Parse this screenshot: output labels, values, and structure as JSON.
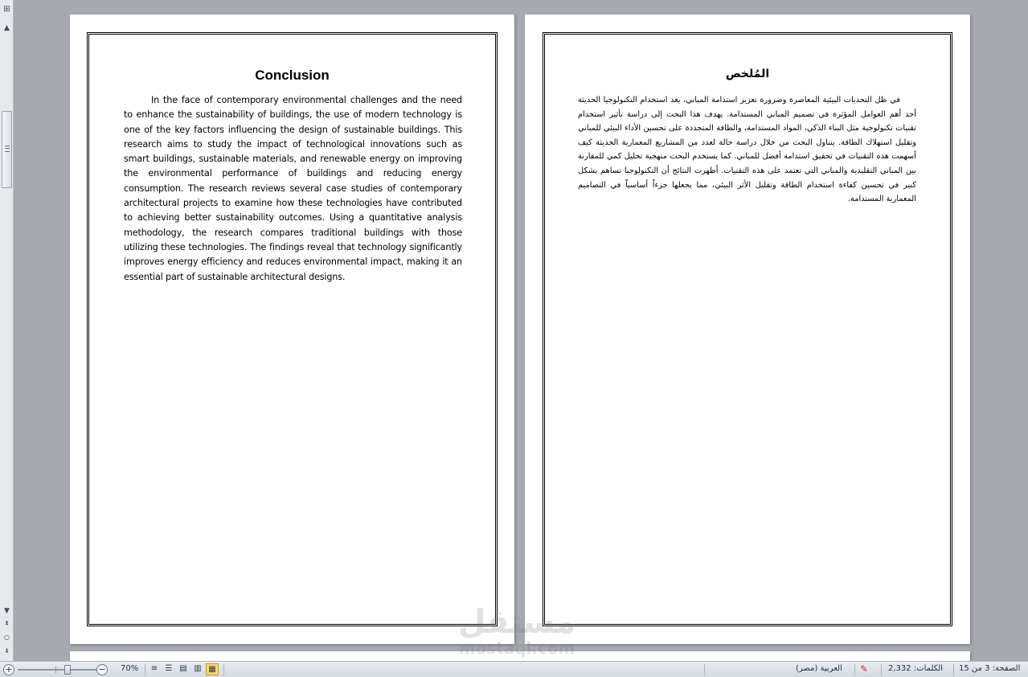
{
  "document": {
    "left_page": {
      "title": "Conclusion",
      "body": "In the face of contemporary environmental challenges and the need to enhance the sustainability of buildings, the use of modern technology is one of the key factors influencing the design of sustainable buildings. This research aims to study the impact of technological innovations such as smart buildings, sustainable materials, and renewable energy on improving the environmental performance of buildings and reducing energy consumption. The research reviews several case studies of contemporary architectural projects to examine how these technologies have contributed to achieving better sustainability outcomes. Using a quantitative analysis methodology, the research compares traditional buildings with those utilizing these technologies. The findings reveal that technology significantly improves energy efficiency and reduces environmental impact, making it an essential part of sustainable architectural designs."
    },
    "right_page": {
      "title": "المُلخص",
      "body": "في ظل التحديات البيئية المعاصرة وضرورة تعزيز استدامة المباني، يعد استخدام التكنولوجيا الحديثة أحد أهم العوامل المؤثرة في تصميم المباني المستدامة. يهدف هذا البحث إلى دراسة تأثير استخدام تقنيات تكنولوجية مثل البناء الذكي، المواد المستدامة، والطاقة المتجددة على تحسين الأداء البيئي للمباني وتقليل استهلاك الطاقة. يتناول البحث من خلال دراسة حالة لعدد من المشاريع المعمارية الحديثة كيف أسهمت هذه التقنيات في تحقيق استدامة أفضل للمباني. كما يستخدم البحث منهجية تحليل كمي للمقارنة بين المباني التقليدية والمباني التي تعتمد على هذه التقنيات. أظهرت النتائج أن التكنولوجيا تساهم بشكل كبير في تحسين كفاءة استخدام الطاقة وتقليل الأثر البيئي، مما يجعلها جزءاً أساسياً في التصاميم المعمارية المستدامة."
    }
  },
  "watermark": {
    "arabic": "مستقل",
    "latin": "mostaql.com"
  },
  "statusbar": {
    "zoom_level": "70%",
    "language": "العربية (مصر)",
    "word_count": "الكلمات: 2,332",
    "page_info": "الصفحة: 3 من 15"
  },
  "icons": {
    "zoom_in": "plus-icon",
    "zoom_out": "minus-icon",
    "proofing": "proofing-icon",
    "scroll_up": "arrow-up-icon",
    "scroll_down": "arrow-down-icon"
  }
}
